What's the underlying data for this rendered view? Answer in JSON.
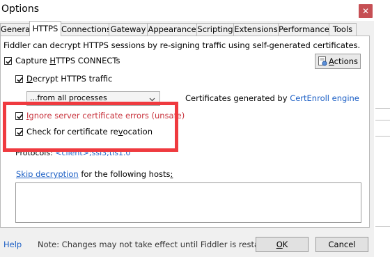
{
  "window": {
    "title": "Options",
    "close_glyph": "✕"
  },
  "tabs": [
    {
      "label": "General"
    },
    {
      "label": "HTTPS",
      "active": true
    },
    {
      "label": "Connections"
    },
    {
      "label": "Gateway"
    },
    {
      "label": "Appearance"
    },
    {
      "label": "Scripting"
    },
    {
      "label": "Extensions"
    },
    {
      "label": "Performance"
    },
    {
      "label": "Tools"
    }
  ],
  "https": {
    "description": "Fiddler can decrypt HTTPS sessions by re-signing traffic using self-generated certificates.",
    "capture": {
      "prefix": "Capture ",
      "accel": "H",
      "suffix": "TTPS CONNECTs",
      "checked": true
    },
    "decrypt": {
      "accel": "D",
      "suffix": "ecrypt HTTPS traffic",
      "checked": true
    },
    "process_filter": {
      "value": "...from all processes"
    },
    "certs_prefix": "Certificates generated by ",
    "certs_engine": "CertEnroll engine",
    "ignore_errors": {
      "accel": "I",
      "suffix": "gnore server certificate errors (unsafe)",
      "checked": true
    },
    "revocation": {
      "prefix": "Check for certificate re",
      "accel": "v",
      "suffix": "ocation",
      "checked": true
    },
    "protocols_label": "Protocols: ",
    "protocols_value": "<client>;ssl3;tls1.0",
    "skip_link": "Skip decryption",
    "skip_middle": " for the following hosts",
    "skip_accel": ":",
    "hosts_value": ""
  },
  "actions_button": {
    "accel": "A",
    "suffix": "ctions",
    "icon": "certificate-icon"
  },
  "footer": {
    "help": "Help",
    "note": "Note: Changes may not take effect until Fiddler is restarted.",
    "ok_accel": "O",
    "ok_suffix": "K",
    "cancel": "Cancel"
  },
  "colors": {
    "link": "#1c5fc5",
    "unsafe": "#c8323c",
    "highlight": "#ef3a3f",
    "close": "#c64f54"
  }
}
